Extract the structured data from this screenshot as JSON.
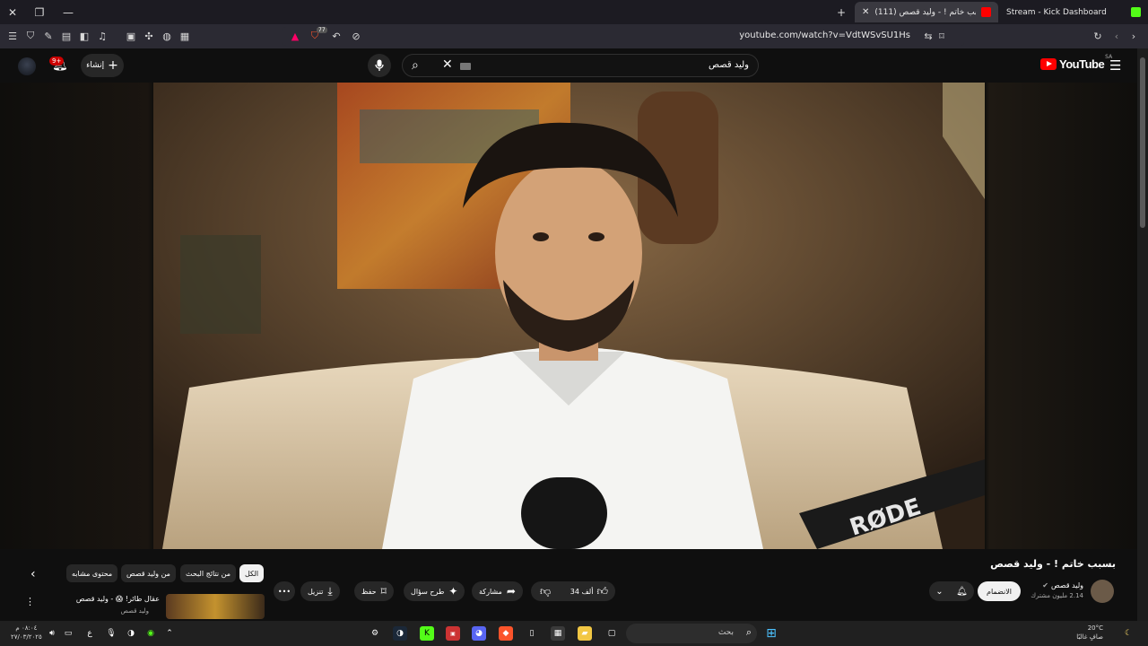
{
  "browser": {
    "tabs": [
      {
        "title": "Stream - Kick Dashboard",
        "active": false
      },
      {
        "title": "(111) بسبب خاتم ! - وليد قصص",
        "active": true
      }
    ],
    "new_tab": "+",
    "url": "youtube.com/watch?v=VdtWSvSU1Hs",
    "extension_count": "77"
  },
  "youtube": {
    "logo_text": "YouTube",
    "country_code": "SA",
    "search_query": "وليد قصص",
    "create_label": "إنشاء",
    "notification_badge": "9+"
  },
  "video": {
    "title": "بسبب خاتم ! - وليد قصص",
    "mic_brand": "RØDE"
  },
  "channel": {
    "name": "وليد قصص",
    "subscribers": "2.14 مليون مشترك",
    "join_label": "الانضمام"
  },
  "actions": {
    "likes": "34 ألف",
    "share": "مشاركة",
    "ask": "طرح سؤال",
    "save": "حفظ",
    "download": "تنزيل"
  },
  "chips": [
    "الكل",
    "من نتائج البحث",
    "من وليد قصص",
    "محتوى مشابه"
  ],
  "recommendation": {
    "title": "عقال طائر! 😱 - وليد قصص",
    "channel": "وليد قصص"
  },
  "taskbar": {
    "search_placeholder": "بحث",
    "weather_temp": "20°C",
    "weather_desc": "صافٍ غالبًا",
    "time": "٠٨:٠٤ م",
    "date": "٢٧/٠٣/٢٠٢٥",
    "lang": "ع"
  },
  "colors": {
    "accent": "#ff0000",
    "chrome_bg": "#2b2a33",
    "page_bg": "#0f0f0f"
  }
}
